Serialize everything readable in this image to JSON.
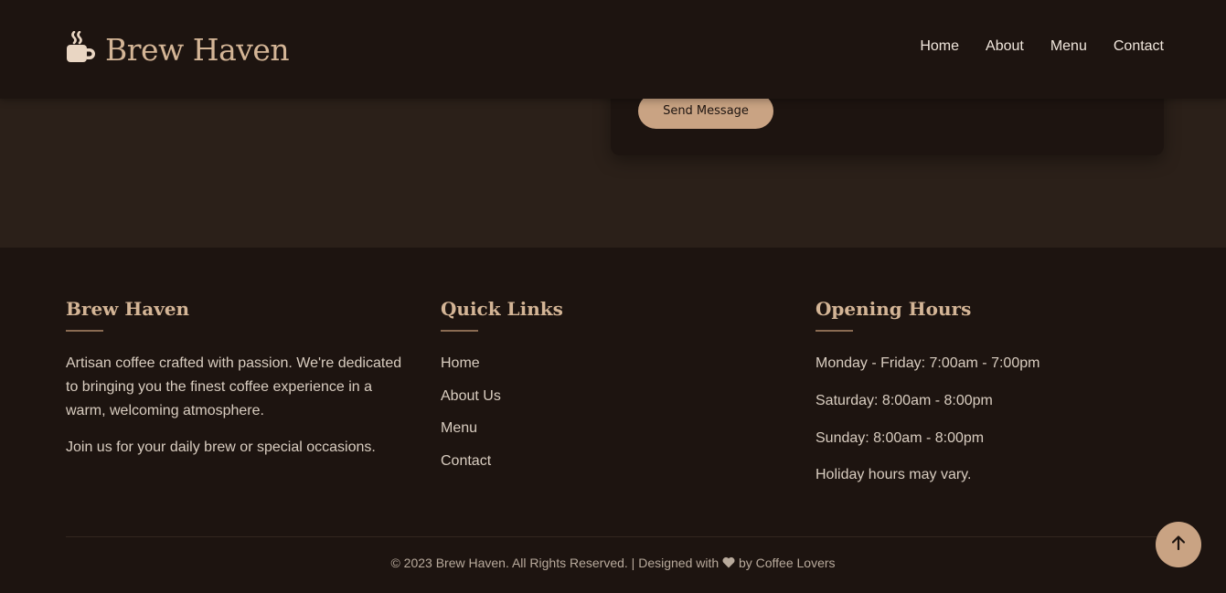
{
  "brand": {
    "name": "Brew Haven",
    "logo_icon": "mug-hot-icon",
    "accent_color": "#d4b596"
  },
  "nav": {
    "items": [
      {
        "label": "Home"
      },
      {
        "label": "About"
      },
      {
        "label": "Menu"
      },
      {
        "label": "Contact"
      }
    ]
  },
  "contact_form": {
    "submit_label": "Send Message"
  },
  "footer": {
    "about": {
      "heading": "Brew Haven",
      "paragraph1": "Artisan coffee crafted with passion. We're dedicated to bringing you the finest coffee experience in a warm, welcoming atmosphere.",
      "paragraph2": "Join us for your daily brew or special occasions."
    },
    "quick_links": {
      "heading": "Quick Links",
      "items": [
        {
          "label": "Home"
        },
        {
          "label": "About Us"
        },
        {
          "label": "Menu"
        },
        {
          "label": "Contact"
        }
      ]
    },
    "hours": {
      "heading": "Opening Hours",
      "items": [
        {
          "text": "Monday - Friday: 7:00am - 7:00pm"
        },
        {
          "text": "Saturday: 8:00am - 8:00pm"
        },
        {
          "text": "Sunday: 8:00am - 8:00pm"
        },
        {
          "text": "Holiday hours may vary."
        }
      ]
    },
    "copyright_prefix": "© 2023 Brew Haven. All Rights Reserved. | Designed with",
    "copyright_suffix": "by Coffee Lovers",
    "heart_icon": "heart-icon"
  },
  "back_to_top": {
    "icon": "arrow-up-icon"
  }
}
